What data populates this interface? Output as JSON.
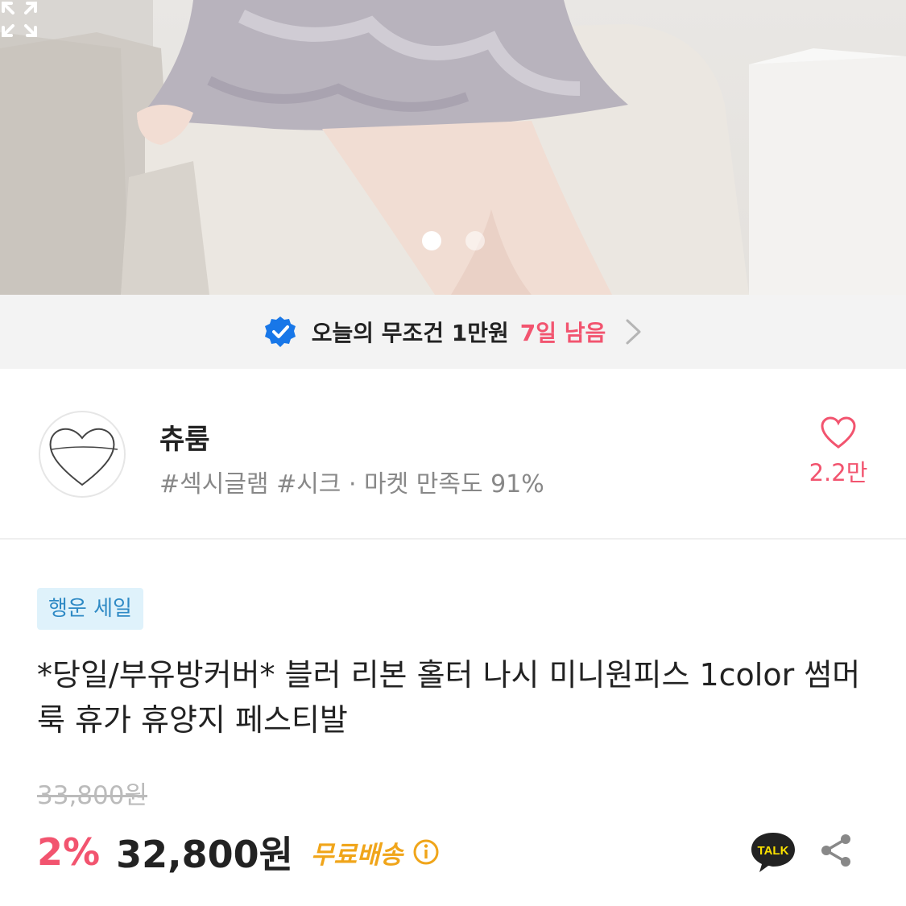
{
  "gallery": {
    "slide_count": 2,
    "active_slide": 1
  },
  "promo": {
    "text": "오늘의 무조건 1만원",
    "days_left": "7일 남음",
    "accent_color": "#f2546f"
  },
  "shop": {
    "name": "츄룸",
    "tags": "#섹시글램 #시크 · 마켓 만족도 91%",
    "like_count": "2.2만"
  },
  "product": {
    "badge": "행운 세일",
    "title": "*당일/부유방커버* 블러 리본 홀터 나시 미니원피스 1color 썸머룩 휴가 휴양지 페스티발",
    "original_price": "33,800원",
    "discount": "2%",
    "price": "32,800원",
    "shipping": "무료배송"
  },
  "icons": {
    "expand": "expand-icon",
    "verified": "verified-check-icon",
    "chevron": "chevron-right-icon",
    "heart": "heart-icon",
    "info": "info-icon",
    "kakao_talk": "kakao-talk-icon",
    "share": "share-icon"
  }
}
